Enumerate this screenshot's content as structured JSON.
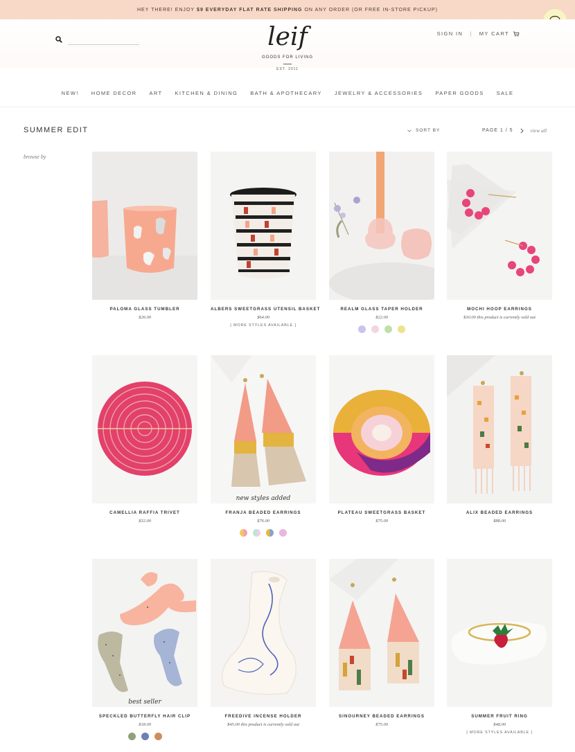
{
  "announcement": {
    "prefix": "HEY THERE! ENJOY",
    "highlight": "$9 EVERYDAY FLAT RATE SHIPPING",
    "suffix": "ON ANY ORDER (OR FREE IN-STORE PICKUP)"
  },
  "header": {
    "logo": "leif",
    "tagline": "GOODS FOR LIVING",
    "established": "EST. 2011",
    "sign_in": "SIGN IN",
    "separator": "|",
    "cart": "MY CART"
  },
  "nav": [
    "NEW!",
    "HOME DECOR",
    "ART",
    "KITCHEN & DINING",
    "BATH & APOTHECARY",
    "JEWELRY & ACCESSORIES",
    "PAPER GOODS",
    "SALE"
  ],
  "collection": {
    "title": "SUMMER EDIT",
    "sort_label": "SORT BY",
    "page_label": "PAGE 1 / 5",
    "view_all": "view all",
    "browse_label": "browse by"
  },
  "products": [
    {
      "name": "PALOMA GLASS TUMBLER",
      "price": "$26.00"
    },
    {
      "name": "ALBERS SWEETGRASS UTENSIL BASKET",
      "price": "$64.00",
      "note": "[ MORE STYLES AVAILABLE ]"
    },
    {
      "name": "REALM GLASS TAPER HOLDER",
      "price": "$22.00",
      "swatches": [
        "#cbc3ec",
        "#f3d6dc",
        "#bfe0a7",
        "#efe28c"
      ]
    },
    {
      "name": "MOCHI HOOP EARRINGS",
      "price": "$30.00 this product is currently sold out"
    },
    {
      "name": "CAMELLIA RAFFIA TRIVET",
      "price": "$32.00"
    },
    {
      "name": "FRANJA BEADED EARRINGS",
      "price": "$76.00",
      "badge": "new styles added",
      "swatches": [
        "#f3c95a",
        "#bfe3d7",
        "#e9b83a",
        "#eab6dc"
      ]
    },
    {
      "name": "PLATEAU SWEETGRASS BASKET",
      "price": "$75.00"
    },
    {
      "name": "ALIX BEADED EARRINGS",
      "price": "$88.00"
    },
    {
      "name": "SPECKLED BUTTERFLY HAIR CLIP",
      "price": "$18.00",
      "badge": "best seller",
      "swatches": [
        "#8fa27d",
        "#6e80b5",
        "#d08c5f"
      ]
    },
    {
      "name": "FREEDIVE INCENSE HOLDER",
      "price": "$45.00 this product is currently sold out"
    },
    {
      "name": "SINOURNEY BEADED EARRINGS",
      "price": "$75.00"
    },
    {
      "name": "SUMMER FRUIT RING",
      "price": "$48.00",
      "note": "[ MORE STYLES AVAILABLE ]"
    }
  ],
  "icons": {
    "search": "search-icon",
    "cart": "cart-icon",
    "chat": "chat-icon",
    "sort": "sort-icon",
    "next": "chevron-right-icon"
  },
  "colors": {
    "announcement_bg": "#f8d9c7",
    "chat_bg": "#fbf3c8",
    "accent_gold": "#c9a65b"
  }
}
